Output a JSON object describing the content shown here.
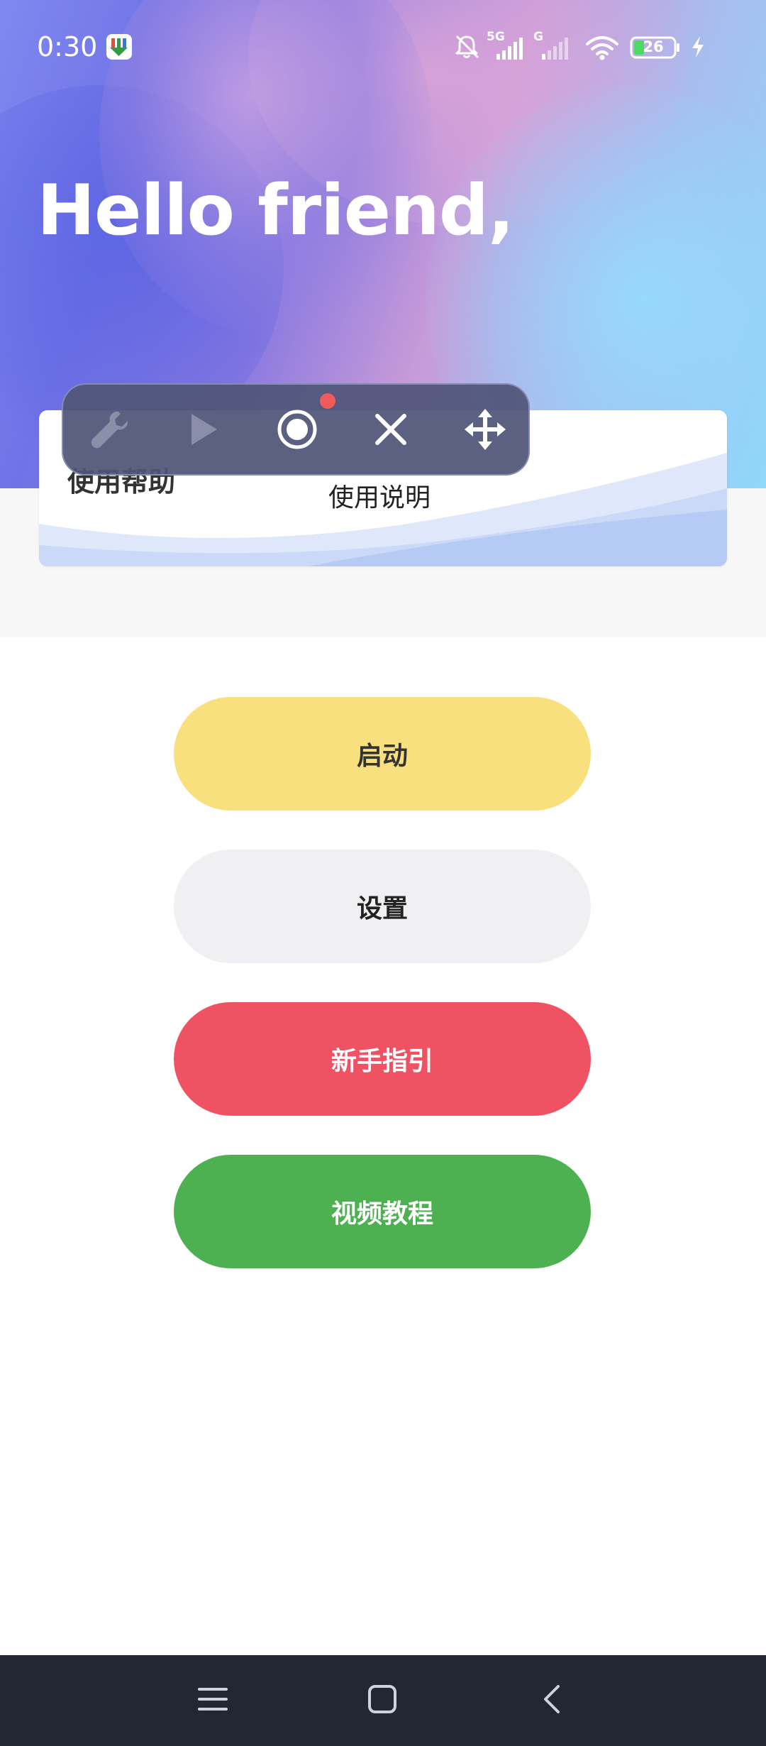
{
  "status_bar": {
    "time": "0:30",
    "network_label_1": "5G",
    "network_label_2": "G",
    "battery_level": "26",
    "app_icon": "download-app-icon",
    "icons": [
      "mute-bell-icon",
      "signal-5g-icon",
      "signal-g-icon",
      "wifi-icon",
      "battery-icon",
      "charging-icon"
    ]
  },
  "hero": {
    "greeting": "Hello friend,"
  },
  "help_card": {
    "title": "使用帮助",
    "link_label": "使用说明"
  },
  "floating_toolbar": {
    "buttons": [
      "wrench-icon",
      "play-icon",
      "record-icon",
      "close-icon",
      "move-icon"
    ],
    "record_indicator_color": "#ef5a5a"
  },
  "buttons": {
    "start": "启动",
    "settings": "设置",
    "guide": "新手指引",
    "video": "视频教程"
  },
  "colors": {
    "start": "#f9e07f",
    "settings": "#f0f0f2",
    "guide": "#ef5262",
    "video": "#4db152",
    "nav_bar": "#222733"
  },
  "nav_bar": {
    "buttons": [
      "menu-icon",
      "home-icon",
      "back-icon"
    ]
  }
}
